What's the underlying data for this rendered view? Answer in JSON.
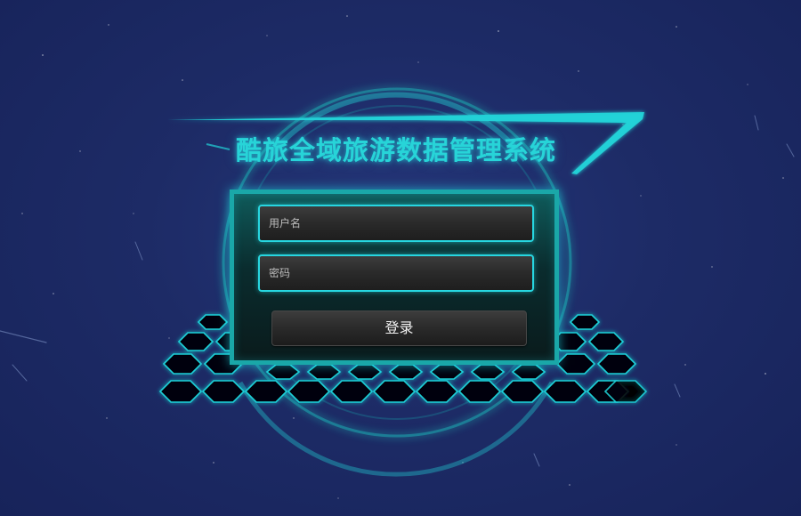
{
  "page": {
    "title": "酷旅全域旅游数据管理系统"
  },
  "login_form": {
    "username_placeholder": "用户名",
    "password_placeholder": "密码",
    "submit_label": "登录"
  },
  "colors": {
    "background": "#1d2b66",
    "accent": "#27d4d8",
    "panel_border": "#1aa7a8",
    "button": "#2a2a2a"
  }
}
